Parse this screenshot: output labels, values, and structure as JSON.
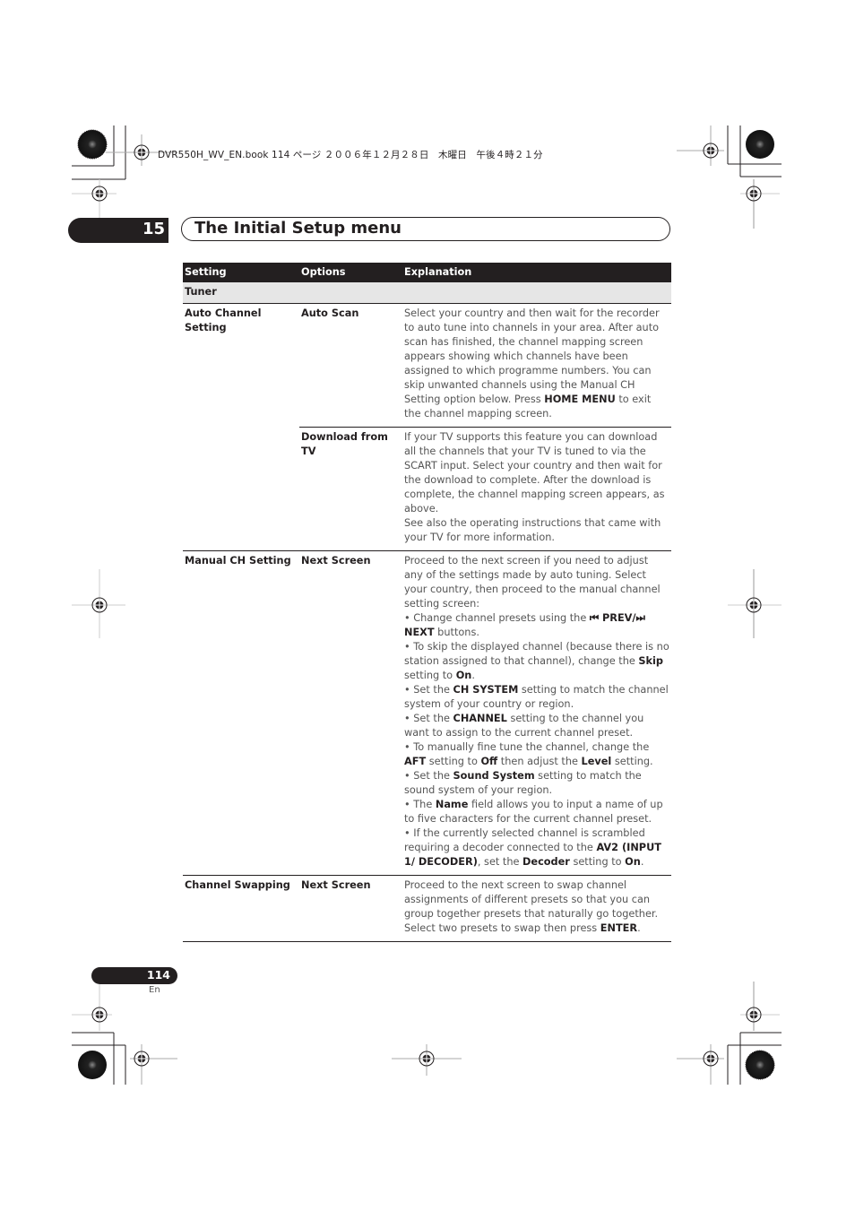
{
  "book_header": "DVR550H_WV_EN.book  114 ページ  ２００６年１２月２８日　木曜日　午後４時２１分",
  "chapter": {
    "number": "15",
    "title": "The Initial Setup menu"
  },
  "table": {
    "headers": [
      "Setting",
      "Options",
      "Explanation"
    ],
    "section": "Tuner",
    "rows": [
      {
        "setting": "Auto Channel Setting",
        "option": "Auto Scan",
        "explanation_html": "Select your country and then wait for the recorder to auto tune into channels in your area. After auto scan has finished, the channel mapping screen appears showing which channels have been assigned to which programme numbers. You can skip unwanted channels using the Manual CH Setting option below. Press <b>HOME MENU</b> to exit the channel mapping screen."
      },
      {
        "setting": "",
        "option": "Download from TV",
        "explanation_html": "If your TV supports this feature you can download all the channels that your TV is tuned to via the SCART input. Select your country and then wait for the download to complete. After the download is complete, the channel mapping screen appears, as above.<br>See also the operating instructions that came with your TV for more information."
      },
      {
        "setting": "Manual CH Setting",
        "option": "Next Screen",
        "explanation_html": "Proceed to the next screen if you need to adjust any of the settings made by auto tuning. Select your country, then proceed to the manual channel setting screen:<br>• Change channel presets using the <b>⏮ PREV/⏭ NEXT</b> buttons.<br>• To skip the displayed channel (because there is no station assigned to that channel), change the <b>Skip</b> setting to <b>On</b>.<br>• Set the <b>CH SYSTEM</b> setting to match the channel system of your country or region.<br>• Set the <b>CHANNEL</b> setting to the channel you want to assign to the current channel preset.<br>• To manually fine tune the channel, change the <b>AFT</b> setting to <b>Off</b> then adjust the <b>Level</b> setting.<br>• Set the <b>Sound System</b> setting to match the sound system of your region.<br>• The <b>Name</b> field allows you to input a name of up to five characters for the current channel preset.<br>• If the currently selected channel is scrambled requiring a decoder connected to the <b>AV2 (INPUT 1/ DECODER)</b>, set the <b>Decoder</b> setting to <b>On</b>."
      },
      {
        "setting": "Channel Swapping",
        "option": "Next Screen",
        "explanation_html": "Proceed to the next screen to swap channel assignments of different presets so that you can group together presets that naturally go together. Select two presets to swap then press <b>ENTER</b>."
      }
    ]
  },
  "footer": {
    "page_number": "114",
    "language": "En"
  }
}
